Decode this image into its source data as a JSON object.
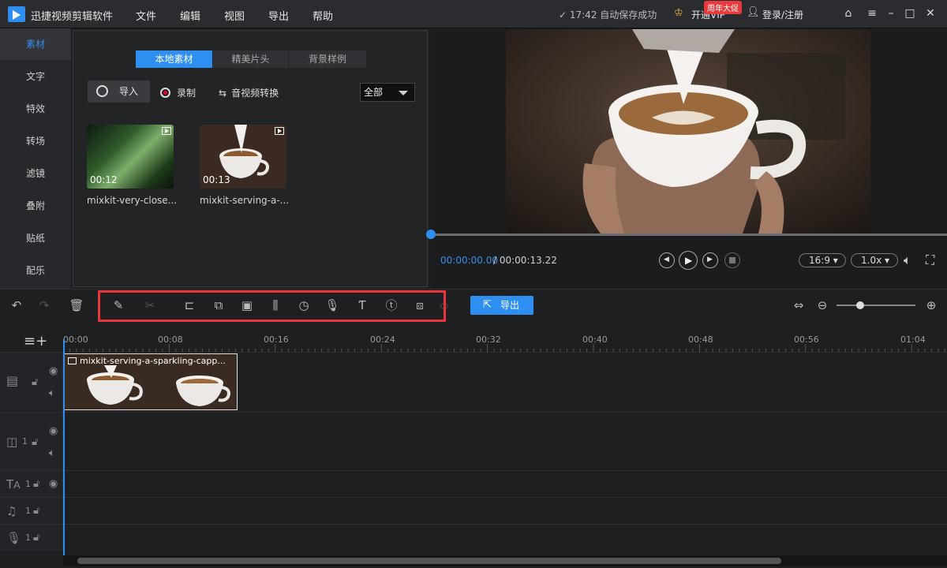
{
  "app": {
    "title": "迅捷视频剪辑软件"
  },
  "menu": [
    "文件",
    "编辑",
    "视图",
    "导出",
    "帮助"
  ],
  "status": {
    "autosave": "✓ 17:42 自动保存成功",
    "vip": "开通VIP",
    "promo": "周年大促",
    "login": "登录/注册"
  },
  "sidebar": {
    "items": [
      {
        "label": "素材",
        "active": true
      },
      {
        "label": "文字"
      },
      {
        "label": "特效"
      },
      {
        "label": "转场"
      },
      {
        "label": "滤镜"
      },
      {
        "label": "叠附"
      },
      {
        "label": "贴纸"
      },
      {
        "label": "配乐"
      }
    ]
  },
  "media": {
    "tabs": [
      "本地素材",
      "精美片头",
      "背景样例"
    ],
    "import_label": "导入",
    "record_label": "录制",
    "convert_label": "音视频转换",
    "filter_value": "全部",
    "clips": [
      {
        "name": "mixkit-very-close...",
        "duration": "00:12"
      },
      {
        "name": "mixkit-serving-a-...",
        "duration": "00:13"
      }
    ]
  },
  "player": {
    "current_time": "00:00:00.00",
    "total_time": "/ 00:00:13.22",
    "aspect_ratio": "16:9",
    "speed": "1.0x",
    "progress": 0
  },
  "toolbar": {
    "export_label": "导出"
  },
  "timeline": {
    "ticks": [
      "00:00",
      "00:08",
      "00:16",
      "00:24",
      "00:32",
      "00:40",
      "00:48",
      "00:56",
      "01:04"
    ],
    "clip_title": "mixkit-serving-a-sparkling-capp...",
    "track_counts": [
      "1",
      "1",
      "1",
      "1"
    ]
  },
  "colors": {
    "accent": "#2f8ff0",
    "highlight": "#e8343a",
    "panel": "#232426"
  }
}
